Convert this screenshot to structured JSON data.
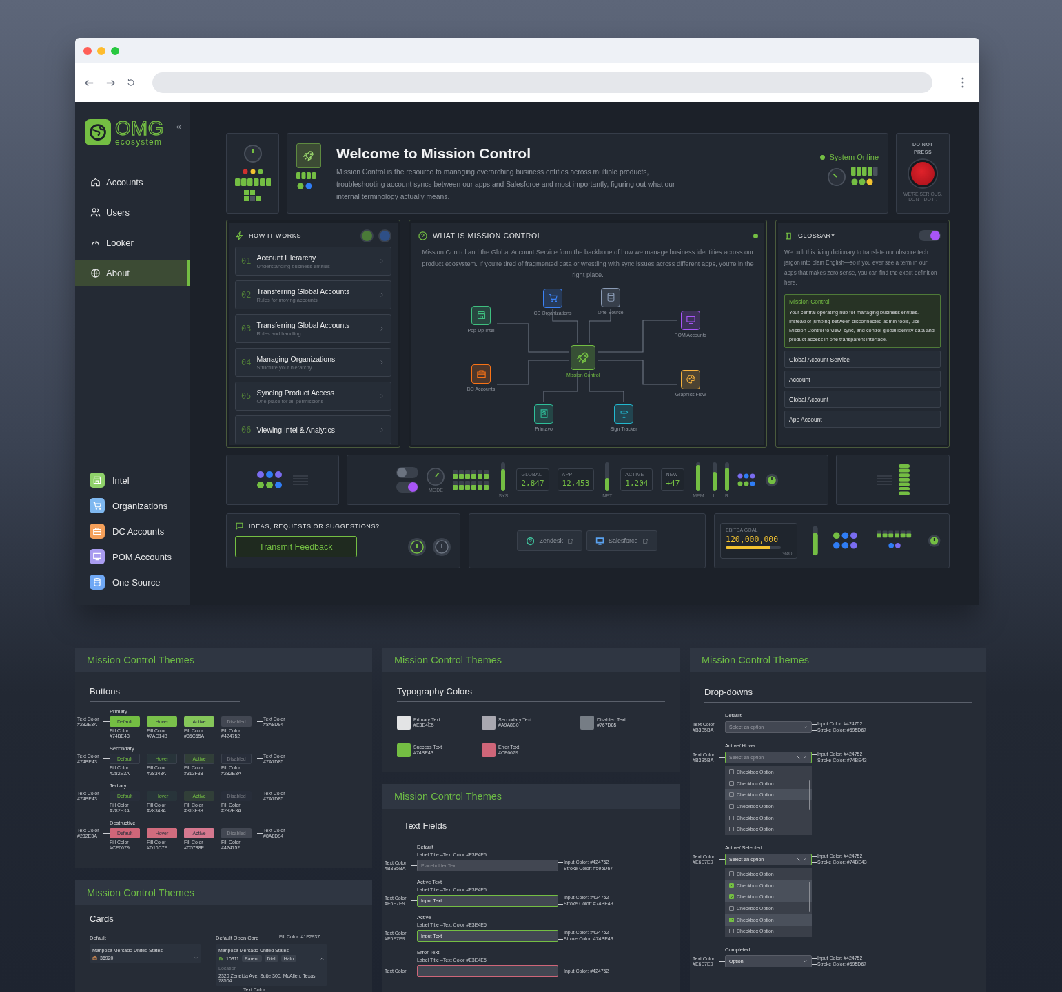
{
  "sidebar": {
    "logo": "OMG",
    "tagline": "ecosystem",
    "collapse_icon": "«",
    "nav": [
      {
        "label": "Accounts",
        "selected": false
      },
      {
        "label": "Users",
        "selected": false
      },
      {
        "label": "Looker",
        "selected": false
      },
      {
        "label": "About",
        "selected": true
      }
    ],
    "apps": [
      {
        "label": "Intel",
        "color": "#8fd16a"
      },
      {
        "label": "Organizations",
        "color": "#7fb8f0"
      },
      {
        "label": "DC Accounts",
        "color": "#f5a05a"
      },
      {
        "label": "POM Accounts",
        "color": "#a99cf0"
      },
      {
        "label": "One Source",
        "color": "#6fa8f5"
      }
    ]
  },
  "welcome": {
    "title": "Welcome to Mission Control",
    "description": "Mission Control is the resource to managing overarching business entities across multiple products, troubleshooting account syncs between our apps and Salesforce and most importantly, figuring out what our internal terminology actually means.",
    "status": "System Online"
  },
  "warning": {
    "label": "DO NOT PRESS",
    "note": "WE'RE SERIOUS. DON'T DO IT."
  },
  "how_it_works": {
    "title": "HOW IT WORKS",
    "steps": [
      {
        "number": "01",
        "title": "Account Hierarchy",
        "subtitle": "Understanding business entities"
      },
      {
        "number": "02",
        "title": "Transferring Global Accounts",
        "subtitle": "Rules for moving accounts"
      },
      {
        "number": "03",
        "title": "Transferring Global Accounts",
        "subtitle": "Rules and handling"
      },
      {
        "number": "04",
        "title": "Managing Organizations",
        "subtitle": "Structure your hierarchy"
      },
      {
        "number": "05",
        "title": "Syncing Product Access",
        "subtitle": "One place for all permissions"
      },
      {
        "number": "06",
        "title": "Viewing Intel & Analytics"
      }
    ]
  },
  "mission": {
    "title": "WHAT IS MISSION CONTROL",
    "description": "Mission Control and the Global Account Service form the backbone of how we manage business identities across our product ecosystem. If you're tired of fragmented data or wrestling with sync issues across different apps, you're in the right place.",
    "center": {
      "label": "Mission Control",
      "color": "#74be43"
    },
    "nodes": [
      {
        "label": "Pop-Up Intel",
        "color": "#3fbf7f"
      },
      {
        "label": "CS Organizations",
        "color": "#3b82f6"
      },
      {
        "label": "One Source",
        "color": "#8a9bb5"
      },
      {
        "label": "POM Accounts",
        "color": "#a855f7"
      },
      {
        "label": "DC Accounts",
        "color": "#f97316"
      },
      {
        "label": "Graphics Flow",
        "color": "#f5b13d"
      },
      {
        "label": "Printavo",
        "color": "#2fbf9a"
      },
      {
        "label": "Sign Tracker",
        "color": "#22b8cf"
      }
    ]
  },
  "glossary": {
    "title": "GLOSSARY",
    "toggle_on": true,
    "intro": "We built this living dictionary to translate our obscure tech jargon into plain English—so if you ever see a term in our apps that makes zero sense, you can find the exact definition here.",
    "featured": {
      "term": "Mission Control",
      "definition": "Your central operating hub for managing business entities. Instead of jumping between disconnected admin tools, use Mission Control to view, sync, and control global identity data and product access in one transparent interface."
    },
    "terms": [
      "Global Account Service",
      "Account",
      "Global Account",
      "App Account"
    ]
  },
  "telemetry": [
    {
      "kind": "toggles",
      "toggles": [
        {
          "on": false
        },
        {
          "on": true
        }
      ]
    },
    {
      "kind": "knob",
      "label": "MODE"
    },
    {
      "kind": "grid"
    },
    {
      "kind": "meter",
      "label": "SYS",
      "level": 0.75
    },
    {
      "kind": "stat",
      "label": "GLOBAL",
      "value": "2,847"
    },
    {
      "kind": "stat",
      "label": "APP",
      "value": "12,453"
    },
    {
      "kind": "meter",
      "label": "NET",
      "level": 0.45
    },
    {
      "kind": "stat",
      "label": "ACTIVE",
      "value": "1,204"
    },
    {
      "kind": "stat",
      "label": "NEW",
      "value": "+47"
    },
    {
      "kind": "meter",
      "label": "MEM",
      "level": 0.9
    },
    {
      "kind": "meter",
      "label": "L",
      "level": 0.65
    },
    {
      "kind": "meter",
      "label": "R",
      "level": 0.8
    },
    {
      "kind": "dots"
    },
    {
      "kind": "power"
    }
  ],
  "feedback": {
    "title": "IDEAS, REQUESTS OR SUGGESTIONS?",
    "button": "Transmit Feedback"
  },
  "links": [
    {
      "label": "Zendesk",
      "color": "#3fbf9a"
    },
    {
      "label": "Salesforce",
      "color": "#5aa2f0"
    }
  ],
  "goal": {
    "label": "EBITDA GOAL",
    "value": "120,000,000",
    "level": 0.8,
    "percent": "%80"
  },
  "themes": {
    "buttons": {
      "heading": "Mission Control Themes",
      "title": "Buttons",
      "groups": [
        {
          "name": "Primary",
          "kind": "primary",
          "left_note": "Text Color #282E3A",
          "right_note": "Text Color #8A8D94",
          "buttons": [
            {
              "label": "Default",
              "fill_label": "Fill Color",
              "color": "#74BE43",
              "disabled": false
            },
            {
              "label": "Hover",
              "fill_label": "Fill Color",
              "color": "#7AC14B",
              "disabled": false
            },
            {
              "label": "Active",
              "fill_label": "Fill Color",
              "color": "#85C65A",
              "disabled": false
            },
            {
              "label": "Disabled",
              "fill_label": "Fill Color",
              "color": "#424752",
              "disabled": true
            }
          ]
        },
        {
          "name": "Secondary",
          "kind": "secondary",
          "left_note": "Text Color #74BE43",
          "right_note": "Text Color #7A7D85",
          "buttons": [
            {
              "label": "Default",
              "fill_label": "Fill Color",
              "color": "#282E3A",
              "disabled": false
            },
            {
              "label": "Hover",
              "fill_label": "Fill Color",
              "color": "#28343A",
              "disabled": false
            },
            {
              "label": "Active",
              "fill_label": "Fill Color",
              "color": "#313F38",
              "disabled": false
            },
            {
              "label": "Disabled",
              "fill_label": "Fill Color",
              "color": "#282E3A",
              "disabled": true
            }
          ]
        },
        {
          "name": "Tertiary",
          "kind": "tertiary",
          "left_note": "Text Color #74BE43",
          "right_note": "Text Color #7A7D85",
          "buttons": [
            {
              "label": "Default",
              "fill_label": "Fill Color",
              "color": "#282E3A",
              "disabled": false
            },
            {
              "label": "Hover",
              "fill_label": "Fill Color",
              "color": "#28343A",
              "disabled": false
            },
            {
              "label": "Active",
              "fill_label": "Fill Color",
              "color": "#313F38",
              "disabled": false
            },
            {
              "label": "Disabled",
              "fill_label": "Fill Color",
              "color": "#282E3A",
              "disabled": true
            }
          ]
        },
        {
          "name": "Destructive",
          "kind": "destructive",
          "left_note": "Text Color #282E3A",
          "right_note": "Text Color #8A8D94",
          "buttons": [
            {
              "label": "Default",
              "fill_label": "Fill Color",
              "color": "#CF6679",
              "disabled": false
            },
            {
              "label": "Hover",
              "fill_label": "Fill Color",
              "color": "#D16C7E",
              "disabled": false
            },
            {
              "label": "Active",
              "fill_label": "Fill Color",
              "color": "#D5788F",
              "disabled": false
            },
            {
              "label": "Disabled",
              "fill_label": "Fill Color",
              "color": "#424752",
              "disabled": true
            }
          ]
        }
      ]
    },
    "cards": {
      "heading": "Mission Control Themes",
      "title": "Cards",
      "default": {
        "caption": "Default",
        "name": "Mariposa Mercado United States",
        "id": "36920"
      },
      "open": {
        "caption": "Default Open Card",
        "name": "Mariposa Mercado United States",
        "id": "10311",
        "tags": [
          "Parent",
          "Dial",
          "Halo"
        ],
        "location_label": "Location",
        "address": "2320 Zeneida Ave, Suite 300, McAllen, Texas, 78504",
        "fill_note": "Fill Color: #1F2937",
        "text_note": "Text Color"
      }
    },
    "typography": {
      "heading": "Mission Control Themes",
      "title": "Typography Colors",
      "swatches": [
        {
          "name": "Primary Text",
          "color": "#E3E4E5"
        },
        {
          "name": "Secondary Text",
          "color": "#A9A8B0"
        },
        {
          "name": "Disabled Text",
          "color": "#767D85"
        },
        {
          "name": "Success Text",
          "color": "#74BE43"
        },
        {
          "name": "Error Text",
          "color": "#CF6679"
        }
      ]
    },
    "text_fields": {
      "heading": "Mission Control Themes",
      "title": "Text Fields",
      "fields": [
        {
          "title": "Default",
          "label": "Label Title",
          "label_note": "–Text Color #E3E4E5",
          "text_note": "Text Color #B3B5BA",
          "kind": "placeholder",
          "placeholder": "Placeholder Text",
          "notes": [
            "Input Color: #424752",
            "Stroke Color: #595D67"
          ]
        },
        {
          "title": "Active Text",
          "label": "Label Title",
          "label_note": "–Text Color #E3E4E5",
          "text_note": "Text Color #E6E7E9",
          "kind": "typing",
          "value": "Input Text",
          "notes": [
            "Input Color: #424752",
            "Stroke Color: #74BE43"
          ]
        },
        {
          "title": "Active",
          "label": "Label Title",
          "label_note": "–Text Color #E3E4E5",
          "text_note": "Text Color #E6E7E9",
          "kind": "filled",
          "value": "Input Text",
          "notes": [
            "Input Color: #424752",
            "Stroke Color: #74BE43"
          ]
        },
        {
          "title": "Error Text",
          "label": "Label Title",
          "label_note": "–Text Color #E3E4E5",
          "text_note": "Text Color",
          "kind": "error",
          "notes": [
            "Input Color: #424752"
          ]
        }
      ]
    },
    "dropdowns": {
      "heading": "Mission Control Themes",
      "title": "Drop-downs",
      "items": [
        {
          "title": "Default",
          "text_note": "Text Color #B3B5BA",
          "kind": "closed",
          "placeholder": "Select an option",
          "notes": [
            "Input Color: #424752",
            "Stroke Color: #595D67"
          ]
        },
        {
          "title": "Active/ Hover",
          "text_note": "Text Color #B3B5BA",
          "kind": "open",
          "placeholder": "Select an option",
          "notes": [
            "Input Color: #424752",
            "Stroke Color: #74BE43"
          ],
          "options": [
            {
              "label": "Checkbox Option",
              "checked": false,
              "highlighted": false
            },
            {
              "label": "Checkbox Option",
              "checked": false,
              "highlighted": false
            },
            {
              "label": "Checkbox Option",
              "checked": false,
              "highlighted": true
            },
            {
              "label": "Checkbox Option",
              "checked": false,
              "highlighted": false
            },
            {
              "label": "Checkbox Option",
              "checked": false,
              "highlighted": false
            },
            {
              "label": "Checkbox Option",
              "checked": false,
              "highlighted": false
            }
          ]
        },
        {
          "title": "Active/ Selected",
          "text_note": "Text Color #E6E7E9",
          "kind": "open",
          "value": "Select an option",
          "notes": [
            "Input Color: #424752",
            "Stroke Color: #74BE43"
          ],
          "options": [
            {
              "label": "Checkbox Option",
              "checked": false,
              "highlighted": false
            },
            {
              "label": "Checkbox Option",
              "checked": true,
              "highlighted": true
            },
            {
              "label": "Checkbox Option",
              "checked": true,
              "highlighted": true
            },
            {
              "label": "Checkbox Option",
              "checked": false,
              "highlighted": false
            },
            {
              "label": "Checkbox Option",
              "checked": true,
              "highlighted": true
            },
            {
              "label": "Checkbox Option",
              "checked": false,
              "highlighted": false
            }
          ]
        },
        {
          "title": "Completed",
          "text_note": "Text Color #E6E7E9",
          "kind": "closed",
          "value": "Option",
          "notes": [
            "Input Color: #424752",
            "Stroke Color: #595D67"
          ]
        }
      ]
    }
  }
}
